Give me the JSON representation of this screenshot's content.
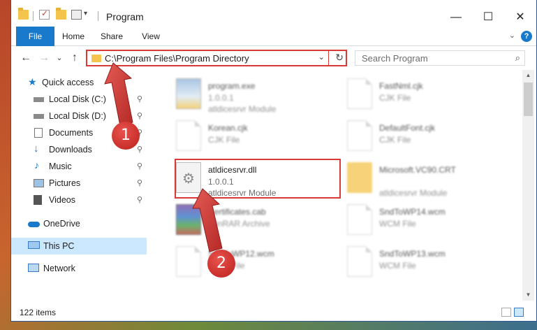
{
  "window": {
    "title": "Program",
    "controls": {
      "minimize": "—",
      "maximize": "☐",
      "close": "✕"
    }
  },
  "ribbon": {
    "tabs": [
      "File",
      "Home",
      "Share",
      "View"
    ],
    "help": "?"
  },
  "navigation": {
    "back": "←",
    "forward": "→",
    "recent": "⌄",
    "up": "↑",
    "address": "C:\\Program Files\\Program Directory",
    "refresh": "↻",
    "search_placeholder": "Search Program"
  },
  "nav_pane": {
    "items": [
      {
        "label": "Quick access",
        "icon": "star-icon",
        "pinned": false
      },
      {
        "label": "Local Disk (C:)",
        "icon": "drive-icon",
        "pinned": true
      },
      {
        "label": "Local Disk (D:)",
        "icon": "drive-icon",
        "pinned": true
      },
      {
        "label": "Documents",
        "icon": "documents-icon",
        "pinned": true
      },
      {
        "label": "Downloads",
        "icon": "download-icon",
        "pinned": true
      },
      {
        "label": "Music",
        "icon": "music-icon",
        "pinned": true
      },
      {
        "label": "Pictures",
        "icon": "pictures-icon",
        "pinned": true
      },
      {
        "label": "Videos",
        "icon": "videos-icon",
        "pinned": true
      },
      {
        "label": "OneDrive",
        "icon": "cloud-icon",
        "pinned": false
      },
      {
        "label": "This PC",
        "icon": "computer-icon",
        "pinned": false,
        "selected": true
      },
      {
        "label": "Network",
        "icon": "network-icon",
        "pinned": false
      }
    ],
    "pin_glyph": "📌"
  },
  "files": [
    {
      "name": "program.exe",
      "line2": "1.0.0.1",
      "line3": "atldicesrvr Module",
      "icon": "exe-icon"
    },
    {
      "name": "FastNml.cjk",
      "line2": "CJK File",
      "line3": "",
      "icon": "document-icon"
    },
    {
      "name": "Korean.cjk",
      "line2": "CJK File",
      "line3": "",
      "icon": "document-icon"
    },
    {
      "name": "DefaultFont.cjk",
      "line2": "CJK File",
      "line3": "",
      "icon": "document-icon"
    },
    {
      "name": "atldicesrvr.dll",
      "line2": "1.0.0.1",
      "line3": "atldicesrvr Module",
      "icon": "dll-gear-icon"
    },
    {
      "name": "Microsoft.VC90.CRT",
      "line2": "",
      "line3": "atldicesrvr Module",
      "icon": "folder-icon"
    },
    {
      "name": "Certificates.cab",
      "line2": "WinRAR Archive",
      "line3": "",
      "icon": "archive-icon"
    },
    {
      "name": "SndToWP14.wcm",
      "line2": "WCM File",
      "line3": "",
      "icon": "document-icon"
    },
    {
      "name": "SndToWP12.wcm",
      "line2": "WCM File",
      "line3": "",
      "icon": "document-icon"
    },
    {
      "name": "SndToWP13.wcm",
      "line2": "WCM File",
      "line3": "",
      "icon": "document-icon"
    }
  ],
  "status": {
    "item_count": "122 items"
  },
  "callouts": {
    "step1": "1",
    "step2": "2"
  },
  "colors": {
    "accent": "#1979ca",
    "highlight_red": "#d93a36",
    "selected_bg": "#cce8ff"
  }
}
